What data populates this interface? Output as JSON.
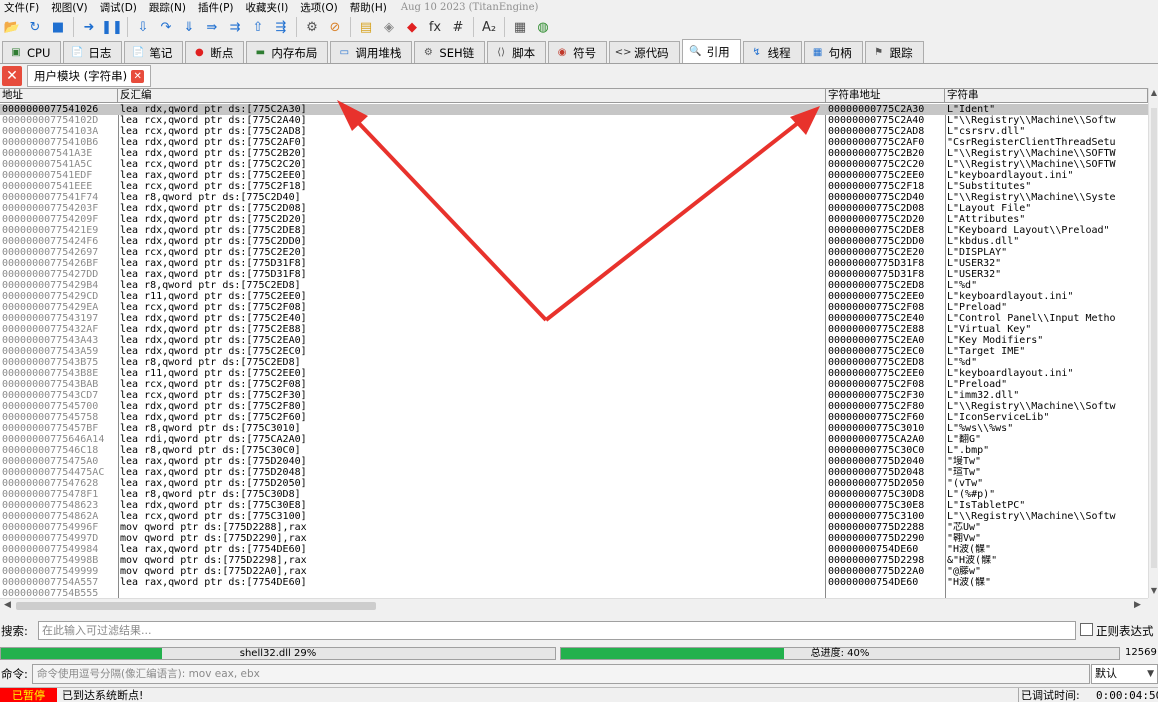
{
  "menu": {
    "items": [
      "文件(F)",
      "视图(V)",
      "调试(D)",
      "跟踪(N)",
      "插件(P)",
      "收藏夹(I)",
      "选项(O)",
      "帮助(H)"
    ],
    "info": "Aug 10 2023 (TitanEngine)"
  },
  "toolbar": {
    "buttons": [
      {
        "name": "open-icon",
        "glyph": "📂",
        "color": "#e3a21a"
      },
      {
        "name": "restart-icon",
        "glyph": "↻",
        "color": "#1f6fd0"
      },
      {
        "name": "stop-icon",
        "glyph": "■",
        "color": "#1f6fd0"
      },
      {
        "name": "run-icon",
        "glyph": "➜",
        "color": "#1f6fd0"
      },
      {
        "name": "pause-icon",
        "glyph": "❚❚",
        "color": "#1f6fd0"
      },
      {
        "name": "step-into-icon",
        "glyph": "⇩",
        "color": "#1f6fd0"
      },
      {
        "name": "step-over-icon",
        "glyph": "↷",
        "color": "#1f6fd0"
      },
      {
        "name": "trace-into-icon",
        "glyph": "⇓",
        "color": "#1f6fd0"
      },
      {
        "name": "trace-over-icon",
        "glyph": "⇛",
        "color": "#1f6fd0"
      },
      {
        "name": "run-to-user-icon",
        "glyph": "⇉",
        "color": "#1f6fd0"
      },
      {
        "name": "execute-till-return-icon",
        "glyph": "⇧",
        "color": "#1f6fd0"
      },
      {
        "name": "run-to-user-code-icon",
        "glyph": "⇶",
        "color": "#1f6fd0"
      },
      {
        "name": "scylla-icon",
        "glyph": "⚙",
        "color": "#555555"
      },
      {
        "name": "patch-icon",
        "glyph": "⊘",
        "color": "#d9822b"
      },
      {
        "name": "comment-icon",
        "glyph": "▤",
        "color": "#d6a21e"
      },
      {
        "name": "label-icon",
        "glyph": "◈",
        "color": "#888888"
      },
      {
        "name": "bookmark-icon",
        "glyph": "◆",
        "color": "#e02020"
      },
      {
        "name": "function-icon",
        "glyph": "fx",
        "color": "#333333"
      },
      {
        "name": "hash-icon",
        "glyph": "#",
        "color": "#333333"
      },
      {
        "name": "font-icon",
        "glyph": "A₂",
        "color": "#333333"
      },
      {
        "name": "calculator-icon",
        "glyph": "▦",
        "color": "#555555"
      },
      {
        "name": "globe-icon",
        "glyph": "◍",
        "color": "#2a8a2a"
      }
    ]
  },
  "tabs": [
    {
      "name": "tab-cpu",
      "icon": "▣",
      "icon_color": "#2f7d32",
      "label": "CPU",
      "active": false
    },
    {
      "name": "tab-log",
      "icon": "📄",
      "icon_color": "#555555",
      "label": "日志",
      "active": false
    },
    {
      "name": "tab-notes",
      "icon": "📄",
      "icon_color": "#555555",
      "label": "笔记",
      "active": false
    },
    {
      "name": "tab-breakpoints",
      "icon": "●",
      "icon_color": "#e02020",
      "label": "断点",
      "active": false
    },
    {
      "name": "tab-memory-map",
      "icon": "▬",
      "icon_color": "#2f7d32",
      "label": "内存布局",
      "active": false
    },
    {
      "name": "tab-call-stack",
      "icon": "▭",
      "icon_color": "#1f6fd0",
      "label": "调用堆栈",
      "active": false
    },
    {
      "name": "tab-seh",
      "icon": "⚙",
      "icon_color": "#555555",
      "label": "SEH链",
      "active": false
    },
    {
      "name": "tab-script",
      "icon": "⟨⟩",
      "icon_color": "#555555",
      "label": "脚本",
      "active": false
    },
    {
      "name": "tab-symbols",
      "icon": "◉",
      "icon_color": "#c0392b",
      "label": "符号",
      "active": false
    },
    {
      "name": "tab-source",
      "icon": "<>",
      "icon_color": "#333333",
      "label": "源代码",
      "active": false
    },
    {
      "name": "tab-references",
      "icon": "🔍",
      "icon_color": "#555555",
      "label": "引用",
      "active": true
    },
    {
      "name": "tab-threads",
      "icon": "↯",
      "icon_color": "#1f6fd0",
      "label": "线程",
      "active": false
    },
    {
      "name": "tab-handles",
      "icon": "▦",
      "icon_color": "#1f6fd0",
      "label": "句柄",
      "active": false
    },
    {
      "name": "tab-trace",
      "icon": "⚑",
      "icon_color": "#555555",
      "label": "跟踪",
      "active": false
    }
  ],
  "subtab": {
    "label": "用户模块 (字符串)"
  },
  "table": {
    "columns": [
      "地址",
      "反汇编",
      "字符串地址",
      "字符串"
    ],
    "rows": [
      {
        "addr": "0000000077541026",
        "dis": "lea rdx,qword ptr ds:[775C2A30]",
        "saddr": "00000000775C2A30",
        "str": "L\"Ident\""
      },
      {
        "addr": "000000007754102D",
        "dis": "lea rcx,qword ptr ds:[775C2A40]",
        "saddr": "00000000775C2A40",
        "str": "L\"\\\\Registry\\\\Machine\\\\Softw"
      },
      {
        "addr": "000000007754103A",
        "dis": "lea rcx,qword ptr ds:[775C2AD8]",
        "saddr": "00000000775C2AD8",
        "str": "L\"csrsrv.dll\""
      },
      {
        "addr": "00000000775410B6",
        "dis": "lea rdx,qword ptr ds:[775C2AF0]",
        "saddr": "00000000775C2AF0",
        "str": "\"CsrRegisterClientThreadSetu"
      },
      {
        "addr": "000000007541A3E",
        "dis": "lea rdx,qword ptr ds:[775C2B20]",
        "saddr": "00000000775C2B20",
        "str": "L\"\\\\Registry\\\\Machine\\\\SOFTW"
      },
      {
        "addr": "000000007541A5C",
        "dis": "lea rcx,qword ptr ds:[775C2C20]",
        "saddr": "00000000775C2C20",
        "str": "L\"\\\\Registry\\\\Machine\\\\SOFTW"
      },
      {
        "addr": "000000007541EDF",
        "dis": "lea rax,qword ptr ds:[775C2EE0]",
        "saddr": "00000000775C2EE0",
        "str": "L\"keyboardlayout.ini\""
      },
      {
        "addr": "000000007541EEE",
        "dis": "lea rcx,qword ptr ds:[775C2F18]",
        "saddr": "00000000775C2F18",
        "str": "L\"Substitutes\""
      },
      {
        "addr": "0000000077541F74",
        "dis": "lea r8,qword ptr ds:[775C2D40]",
        "saddr": "00000000775C2D40",
        "str": "L\"\\\\Registry\\\\Machine\\\\Syste"
      },
      {
        "addr": "000000007754203F",
        "dis": "lea rdx,qword ptr ds:[775C2D08]",
        "saddr": "00000000775C2D08",
        "str": "L\"Layout File\""
      },
      {
        "addr": "000000007754209F",
        "dis": "lea rdx,qword ptr ds:[775C2D20]",
        "saddr": "00000000775C2D20",
        "str": "L\"Attributes\""
      },
      {
        "addr": "00000000775421E9",
        "dis": "lea rdx,qword ptr ds:[775C2DE8]",
        "saddr": "00000000775C2DE8",
        "str": "L\"Keyboard Layout\\\\Preload\""
      },
      {
        "addr": "00000000775424F6",
        "dis": "lea rdx,qword ptr ds:[775C2DD0]",
        "saddr": "00000000775C2DD0",
        "str": "L\"kbdus.dll\""
      },
      {
        "addr": "0000000077542697",
        "dis": "lea rcx,qword ptr ds:[775C2E20]",
        "saddr": "00000000775C2E20",
        "str": "L\"DISPLAY\""
      },
      {
        "addr": "00000000775426BF",
        "dis": "lea rax,qword ptr ds:[775D31F8]",
        "saddr": "00000000775D31F8",
        "str": "L\"USER32\""
      },
      {
        "addr": "00000000775427DD",
        "dis": "lea rax,qword ptr ds:[775D31F8]",
        "saddr": "00000000775D31F8",
        "str": "L\"USER32\""
      },
      {
        "addr": "00000000775429B4",
        "dis": "lea r8,qword ptr ds:[775C2ED8]",
        "saddr": "00000000775C2ED8",
        "str": "L\"%d\""
      },
      {
        "addr": "00000000775429CD",
        "dis": "lea r11,qword ptr ds:[775C2EE0]",
        "saddr": "00000000775C2EE0",
        "str": "L\"keyboardlayout.ini\""
      },
      {
        "addr": "00000000775429EA",
        "dis": "lea rcx,qword ptr ds:[775C2F08]",
        "saddr": "00000000775C2F08",
        "str": "L\"Preload\""
      },
      {
        "addr": "0000000077543197",
        "dis": "lea rdx,qword ptr ds:[775C2E40]",
        "saddr": "00000000775C2E40",
        "str": "L\"Control Panel\\\\Input Metho"
      },
      {
        "addr": "00000000775432AF",
        "dis": "lea rdx,qword ptr ds:[775C2E88]",
        "saddr": "00000000775C2E88",
        "str": "L\"Virtual Key\""
      },
      {
        "addr": "0000000077543A43",
        "dis": "lea rdx,qword ptr ds:[775C2EA0]",
        "saddr": "00000000775C2EA0",
        "str": "L\"Key Modifiers\""
      },
      {
        "addr": "0000000077543A59",
        "dis": "lea rdx,qword ptr ds:[775C2EC0]",
        "saddr": "00000000775C2EC0",
        "str": "L\"Target IME\""
      },
      {
        "addr": "0000000077543B75",
        "dis": "lea r8,qword ptr ds:[775C2ED8]",
        "saddr": "00000000775C2ED8",
        "str": "L\"%d\""
      },
      {
        "addr": "0000000077543B8E",
        "dis": "lea r11,qword ptr ds:[775C2EE0]",
        "saddr": "00000000775C2EE0",
        "str": "L\"keyboardlayout.ini\""
      },
      {
        "addr": "0000000077543BAB",
        "dis": "lea rcx,qword ptr ds:[775C2F08]",
        "saddr": "00000000775C2F08",
        "str": "L\"Preload\""
      },
      {
        "addr": "0000000077543CD7",
        "dis": "lea rcx,qword ptr ds:[775C2F30]",
        "saddr": "00000000775C2F30",
        "str": "L\"imm32.dll\""
      },
      {
        "addr": "0000000077545700",
        "dis": "lea rdx,qword ptr ds:[775C2F80]",
        "saddr": "00000000775C2F80",
        "str": "L\"\\\\Registry\\\\Machine\\\\Softw"
      },
      {
        "addr": "0000000077545758",
        "dis": "lea rdx,qword ptr ds:[775C2F60]",
        "saddr": "00000000775C2F60",
        "str": "L\"IconServiceLib\""
      },
      {
        "addr": "00000000775457BF",
        "dis": "lea r8,qword ptr ds:[775C3010]",
        "saddr": "00000000775C3010",
        "str": "L\"%ws\\\\%ws\""
      },
      {
        "addr": "00000000775646A14",
        "dis": "lea rdi,qword ptr ds:[775CA2A0]",
        "saddr": "00000000775CA2A0",
        "str": "L\"翻G\""
      },
      {
        "addr": "0000000077546C18",
        "dis": "lea r8,qword ptr ds:[775C30C0]",
        "saddr": "00000000775C30C0",
        "str": "L\".bmp\""
      },
      {
        "addr": "00000000775475A0",
        "dis": "lea rax,qword ptr ds:[775D2040]",
        "saddr": "00000000775D2040",
        "str": "\"墁Tw\""
      },
      {
        "addr": "000000007754475AC",
        "dis": "lea rax,qword ptr ds:[775D2048]",
        "saddr": "00000000775D2048",
        "str": "\"瑄Tw\""
      },
      {
        "addr": "0000000077547628",
        "dis": "lea rax,qword ptr ds:[775D2050]",
        "saddr": "00000000775D2050",
        "str": "\"(vTw\""
      },
      {
        "addr": "00000000775478F1",
        "dis": "lea r8,qword ptr ds:[775C30D8]",
        "saddr": "00000000775C30D8",
        "str": "L\"(%#p)\""
      },
      {
        "addr": "0000000077548623",
        "dis": "lea rdx,qword ptr ds:[775C30E8]",
        "saddr": "00000000775C30E8",
        "str": "L\"IsTabletPC\""
      },
      {
        "addr": "000000007754862A",
        "dis": "lea rcx,qword ptr ds:[775C3100]",
        "saddr": "00000000775C3100",
        "str": "L\"\\\\Registry\\\\Machine\\\\Softw"
      },
      {
        "addr": "000000007754996F",
        "dis": "mov qword ptr ds:[775D2288],rax",
        "saddr": "00000000775D2288",
        "str": "\"芯Uw\""
      },
      {
        "addr": "000000007754997D",
        "dis": "mov qword ptr ds:[775D2290],rax",
        "saddr": "00000000775D2290",
        "str": "\"翱Vw\""
      },
      {
        "addr": "0000000077549984",
        "dis": "lea rax,qword ptr ds:[7754DE60]",
        "saddr": "00000000754DE60",
        "str": "\"H波(髁\""
      },
      {
        "addr": "000000007754998B",
        "dis": "mov qword ptr ds:[775D2298],rax",
        "saddr": "00000000775D2298",
        "str": "&\"H波(髁\""
      },
      {
        "addr": "0000000077549999",
        "dis": "mov qword ptr ds:[775D22A0],rax",
        "saddr": "00000000775D22A0",
        "str": "\"@籐w\""
      },
      {
        "addr": "000000007754A557",
        "dis": "lea rax,qword ptr ds:[7754DE60]",
        "saddr": "00000000754DE60",
        "str": "\"H波(髁\""
      },
      {
        "addr": "000000007754B555",
        "dis": "",
        "saddr": "",
        "str": ""
      }
    ]
  },
  "search": {
    "label": "搜索:",
    "placeholder": "在此输入可过滤结果...",
    "regex_label": "正则表达式"
  },
  "progress": {
    "module_label": "shell32.dll 29%",
    "module_percent": 29,
    "total_label": "总进度: 40%",
    "total_percent": 40,
    "count": "12569"
  },
  "command": {
    "label": "命令:",
    "placeholder": "命令使用逗号分隔(像汇编语言): mov eax, ebx",
    "default": "默认"
  },
  "status": {
    "state": "已暂停",
    "message": "已到达系统断点!",
    "time_label": "已调试时间:",
    "time": "0:00:04:50"
  },
  "colors": {
    "progress_green": "#23b14d",
    "state_bg": "#ff0000",
    "state_text": "#ffff00",
    "arrow_red": "#e8322c",
    "selected_row": "#c6c6c6"
  }
}
